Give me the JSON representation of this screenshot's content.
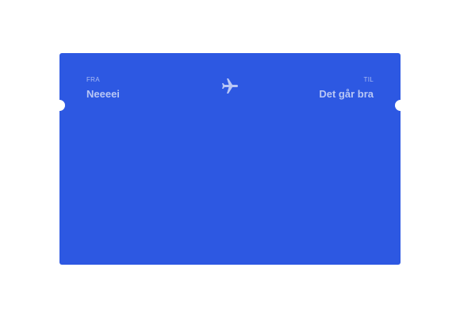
{
  "ticket": {
    "from": {
      "label": "FRA",
      "value": "Neeeei"
    },
    "to": {
      "label": "TIL",
      "value": "Det går bra"
    },
    "icon": "airplane-icon"
  },
  "colors": {
    "ticket_background": "#2d58e2",
    "text": "#b9c7f5",
    "page_background": "#ffffff"
  }
}
